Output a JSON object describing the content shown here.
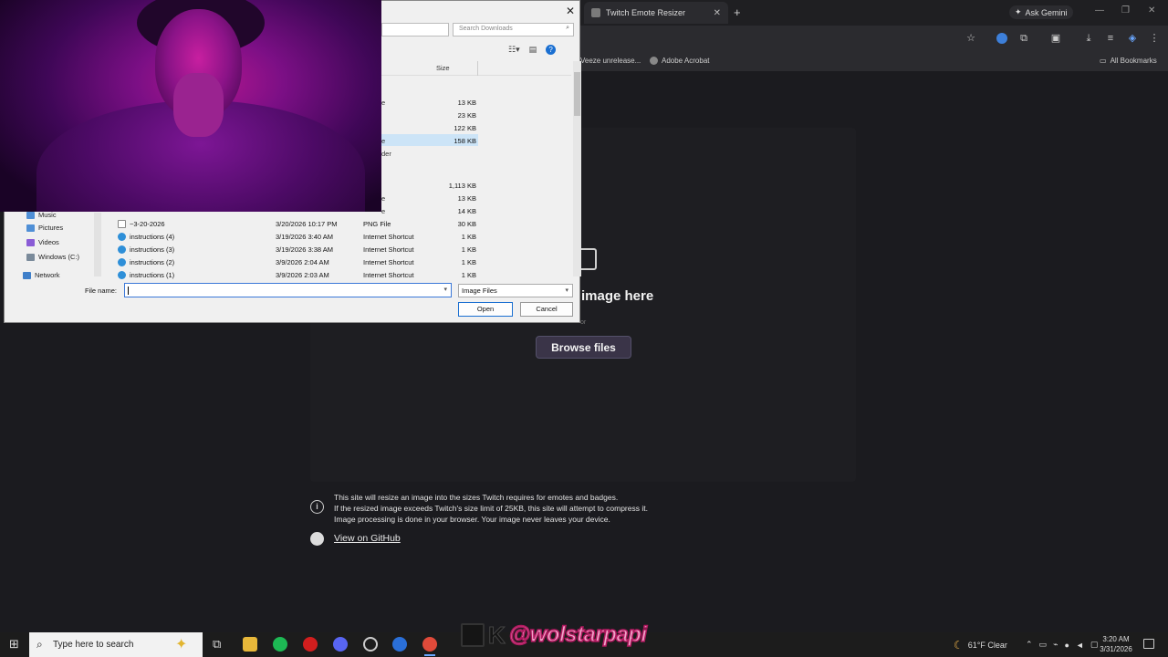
{
  "browser": {
    "tab_title": "Twitch Emote Resizer",
    "tab_close": "✕",
    "new_tab": "+",
    "ask_gemini": "Ask Gemini",
    "bookmarks": [
      {
        "label": "Veeze unrelease..."
      },
      {
        "label": "Adobe Acrobat"
      }
    ],
    "all_bookmarks": "All Bookmarks"
  },
  "page": {
    "drop_text": "image here",
    "or_text": "or",
    "browse_label": "Browse files",
    "info_lines": [
      "This site will resize an image into the sizes Twitch requires for emotes and badges.",
      "If the resized image exceeds Twitch's size limit of 25KB, this site will attempt to compress it.",
      "Image processing is done in your browser. Your image never leaves your device."
    ],
    "github_link": "View on GitHub"
  },
  "dialog": {
    "search_placeholder": "Search Downloads",
    "size_header": "Size",
    "partial_sizes": [
      "13 KB",
      "23 KB",
      "122 KB",
      "158 KB",
      "1,113 KB",
      "13 KB",
      "14 KB"
    ],
    "partial_frags": [
      "e",
      "",
      "",
      "e",
      "der",
      "",
      "e",
      "e"
    ],
    "nav_items": [
      {
        "label": "Music",
        "icon": "music-icon"
      },
      {
        "label": "Pictures",
        "icon": "pictures-icon"
      },
      {
        "label": "Videos",
        "icon": "videos-icon"
      },
      {
        "label": "Windows (C:)",
        "icon": "drive-icon"
      },
      {
        "label": "Network",
        "icon": "network-icon"
      }
    ],
    "files": [
      {
        "name": "~3-20-2026",
        "date": "3/20/2026 10:17 PM",
        "type": "PNG File",
        "size": "30 KB",
        "icon": "png-file-icon"
      },
      {
        "name": "instructions (4)",
        "date": "3/19/2026 3:40 AM",
        "type": "Internet Shortcut",
        "size": "1 KB",
        "icon": "shortcut-icon"
      },
      {
        "name": "instructions (3)",
        "date": "3/19/2026 3:38 AM",
        "type": "Internet Shortcut",
        "size": "1 KB",
        "icon": "shortcut-icon"
      },
      {
        "name": "instructions (2)",
        "date": "3/9/2026 2:04 AM",
        "type": "Internet Shortcut",
        "size": "1 KB",
        "icon": "shortcut-icon"
      },
      {
        "name": "instructions (1)",
        "date": "3/9/2026 2:03 AM",
        "type": "Internet Shortcut",
        "size": "1 KB",
        "icon": "shortcut-icon"
      }
    ],
    "file_name_label": "File name:",
    "file_name_value": "",
    "file_type": "Image Files",
    "open_label": "Open",
    "cancel_label": "Cancel"
  },
  "taskbar": {
    "search_placeholder": "Type here to search",
    "overlay_handle": "@wolstarpapi",
    "weather": "61°F  Clear",
    "time": "3:20 AM",
    "date": "3/31/2026"
  },
  "colors": {
    "page_bg": "#1b1b1f",
    "browse_button": "#3a3448",
    "dialog_bg": "#f0f0f0",
    "selection": "#cce4f7",
    "overlay_pink": "#f3a3c9"
  }
}
